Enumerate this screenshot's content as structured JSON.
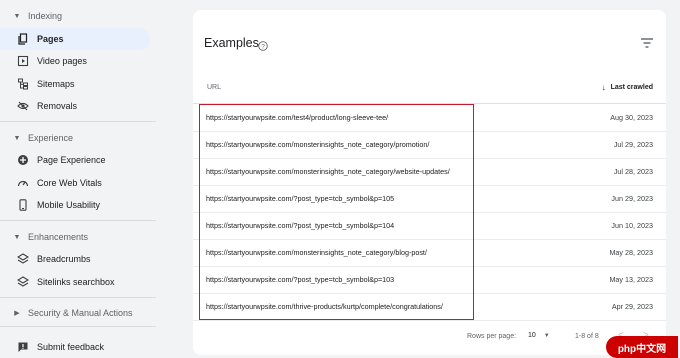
{
  "sidebar": {
    "indexing_header": "Indexing",
    "indexing_items": [
      {
        "label": "Pages",
        "icon": "pages-icon"
      },
      {
        "label": "Video pages",
        "icon": "video-pages-icon"
      },
      {
        "label": "Sitemaps",
        "icon": "sitemaps-icon"
      },
      {
        "label": "Removals",
        "icon": "removals-icon"
      }
    ],
    "experience_header": "Experience",
    "experience_items": [
      {
        "label": "Page Experience",
        "icon": "page-experience-icon"
      },
      {
        "label": "Core Web Vitals",
        "icon": "core-web-vitals-icon"
      },
      {
        "label": "Mobile Usability",
        "icon": "mobile-usability-icon"
      }
    ],
    "enhancements_header": "Enhancements",
    "enhancements_items": [
      {
        "label": "Breadcrumbs",
        "icon": "breadcrumbs-icon"
      },
      {
        "label": "Sitelinks searchbox",
        "icon": "sitelinks-searchbox-icon"
      }
    ],
    "security_header": "Security & Manual Actions",
    "feedback_label": "Submit feedback"
  },
  "examples": {
    "title": "Examples",
    "col_url": "URL",
    "col_last_crawled": "Last crawled",
    "rows": [
      {
        "url": "https://startyourwpsite.com/test4/product/long-sleeve-tee/",
        "date": "Aug 30, 2023"
      },
      {
        "url": "https://startyourwpsite.com/monsterinsights_note_category/promotion/",
        "date": "Jul 29, 2023"
      },
      {
        "url": "https://startyourwpsite.com/monsterinsights_note_category/website-updates/",
        "date": "Jul 28, 2023"
      },
      {
        "url": "https://startyourwpsite.com/?post_type=tcb_symbol&p=105",
        "date": "Jun 29, 2023"
      },
      {
        "url": "https://startyourwpsite.com/?post_type=tcb_symbol&p=104",
        "date": "Jun 10, 2023"
      },
      {
        "url": "https://startyourwpsite.com/monsterinsights_note_category/blog-post/",
        "date": "May 28, 2023"
      },
      {
        "url": "https://startyourwpsite.com/?post_type=tcb_symbol&p=103",
        "date": "May 13, 2023"
      },
      {
        "url": "https://startyourwpsite.com/thrive-products/kurtp/complete/congratulations/",
        "date": "Apr 29, 2023"
      }
    ],
    "rows_per_page_label": "Rows per page:",
    "rows_per_page_value": "10",
    "range_text": "1-8 of 8"
  },
  "watermark": "php中文网",
  "colors": {
    "highlight": "#c5192d",
    "active_nav": "#e8f0fe"
  }
}
